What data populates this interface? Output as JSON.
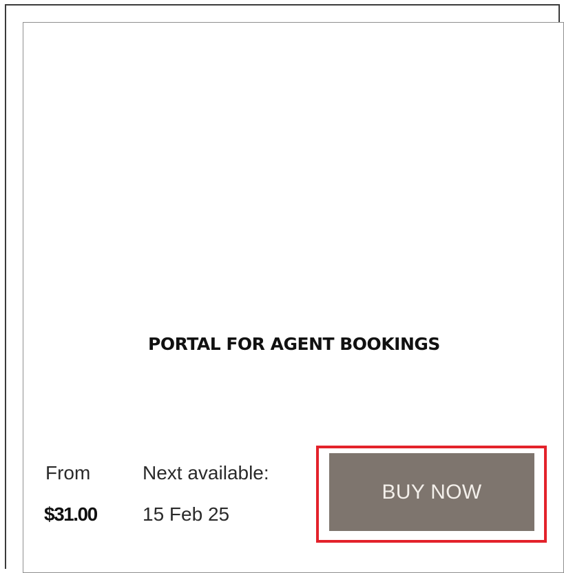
{
  "card": {
    "title": "PORTAL FOR AGENT BOOKINGS",
    "price_label": "From",
    "price_value": "$31.00",
    "availability_label": "Next available:",
    "availability_value": "15 Feb 25",
    "buy_button_label": "BUY NOW"
  },
  "colors": {
    "button_background": "#7e756e",
    "button_text": "#f3efea",
    "highlight_border": "#e3222b",
    "card_border": "#8e8e8e"
  }
}
